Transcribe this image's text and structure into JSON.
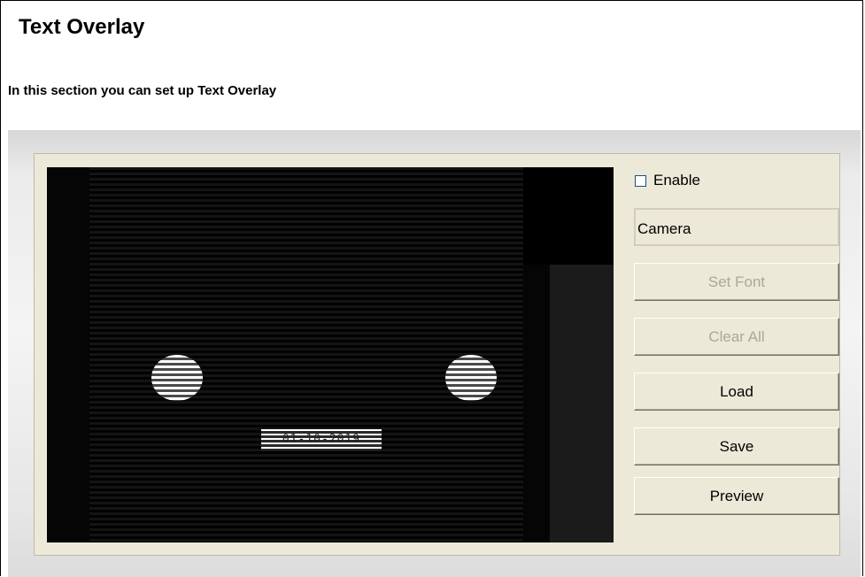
{
  "page": {
    "title": "Text Overlay",
    "subtitle": "In this section you can set up Text Overlay"
  },
  "preview": {
    "overlay_text": "01-10-2019"
  },
  "controls": {
    "enable_label": "Enable",
    "enable_checked": false,
    "text_value": "Camera",
    "buttons": {
      "set_font": "Set Font",
      "clear_all": "Clear All",
      "load": "Load",
      "save": "Save",
      "preview": "Preview"
    }
  }
}
